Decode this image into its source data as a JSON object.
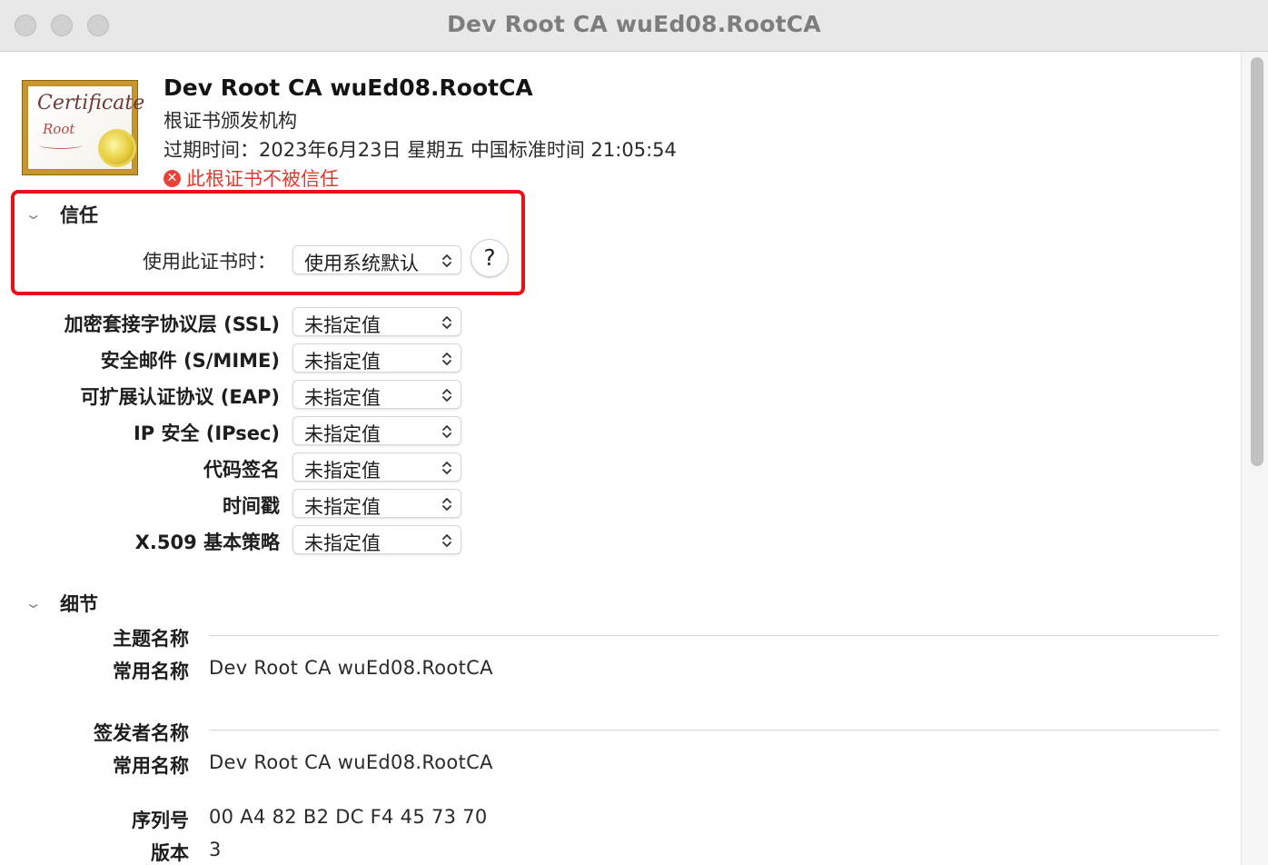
{
  "window": {
    "title": "Dev Root CA wuEd08.RootCA"
  },
  "certificate": {
    "icon": "certificate-icon",
    "icon_text": "Certificate",
    "icon_subtext": "Root",
    "name": "Dev Root CA wuEd08.RootCA",
    "kind": "根证书颁发机构",
    "expiry": "过期时间：2023年6月23日 星期五 中国标准时间 21:05:54",
    "warning": "此根证书不被信任",
    "warning_color": "#e23a2f"
  },
  "trust": {
    "section_title": "信任",
    "when_using_label": "使用此证书时：",
    "when_using_value": "使用系统默认",
    "help_label": "?",
    "policies": [
      {
        "label": "加密套接字协议层 (SSL)",
        "value": "未指定值"
      },
      {
        "label": "安全邮件 (S/MIME)",
        "value": "未指定值"
      },
      {
        "label": "可扩展认证协议 (EAP)",
        "value": "未指定值"
      },
      {
        "label": "IP 安全 (IPsec)",
        "value": "未指定值"
      },
      {
        "label": "代码签名",
        "value": "未指定值"
      },
      {
        "label": "时间戳",
        "value": "未指定值"
      },
      {
        "label": "X.509 基本策略",
        "value": "未指定值"
      }
    ]
  },
  "details": {
    "section_title": "细节",
    "subject_heading": "主题名称",
    "subject_cn_label": "常用名称",
    "subject_cn_value": "Dev Root CA wuEd08.RootCA",
    "issuer_heading": "签发者名称",
    "issuer_cn_label": "常用名称",
    "issuer_cn_value": "Dev Root CA wuEd08.RootCA",
    "serial_label": "序列号",
    "serial_value": "00 A4 82 B2 DC F4 45 73 70",
    "version_label": "版本",
    "version_value": "3"
  },
  "highlight_color": "#e8111a"
}
